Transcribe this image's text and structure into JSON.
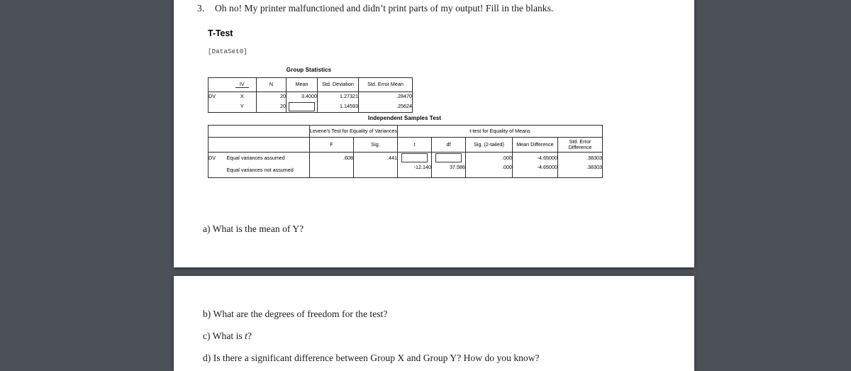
{
  "document": {
    "question_number": "3.",
    "question_text": "Oh no! My printer malfunctioned and didn’t print parts of my output! Fill in the blanks.",
    "spss_heading": "T-Test",
    "dataset_label": "[DataSet0]"
  },
  "group_statistics": {
    "title": "Group Statistics",
    "corner_label": "",
    "group_col_header": "IV",
    "columns": [
      "N",
      "Mean",
      "Std. Deviation",
      "Std. Error Mean"
    ],
    "row_block_label": "DV",
    "rows": [
      {
        "group": "X",
        "n": "20",
        "mean": "3.4000",
        "mean_blank": false,
        "std_deviation": "1.27321",
        "std_error_mean": ".28470"
      },
      {
        "group": "Y",
        "n": "20",
        "mean": "",
        "mean_blank": true,
        "std_deviation": "1.14593",
        "std_error_mean": ".25624"
      }
    ]
  },
  "independent_samples_test": {
    "title": "Independent Samples Test",
    "group_headers": [
      "Levene's Test for Equality of Variances",
      "t-test for Equality of Means"
    ],
    "columns": [
      "F",
      "Sig.",
      "t",
      "df",
      "Sig. (2-tailed)",
      "Mean Difference",
      "Std. Error Difference"
    ],
    "row_block_label": "DV",
    "rows": [
      {
        "label": "Equal variances assumed",
        "f": ".608",
        "sig": ".441",
        "t": "",
        "t_blank": true,
        "df": "",
        "df_blank": true,
        "sig2": ".000",
        "mean_difference": "-4.65000",
        "std_error_difference": ".38303"
      },
      {
        "label": "Equal variances not assumed",
        "f": "",
        "sig": "",
        "t": "-12.140",
        "t_blank": false,
        "df": "37.586",
        "df_blank": false,
        "sig2": ".000",
        "mean_difference": "-4.65000",
        "std_error_difference": ".38303"
      }
    ]
  },
  "sub_questions": {
    "a": "a) What is the mean of Y?",
    "b": "b) What are the degrees of freedom for the test?",
    "c_prefix": "c) What is ",
    "c_italic": "t",
    "c_suffix": "?",
    "d": "d) Is there a significant difference between Group X and Group Y? How do you know?"
  },
  "colors": {
    "app_background": "#4b5156",
    "page_background": "#ffffff",
    "table_rule": "#2b2b2b",
    "text": "#1a1a1a"
  }
}
